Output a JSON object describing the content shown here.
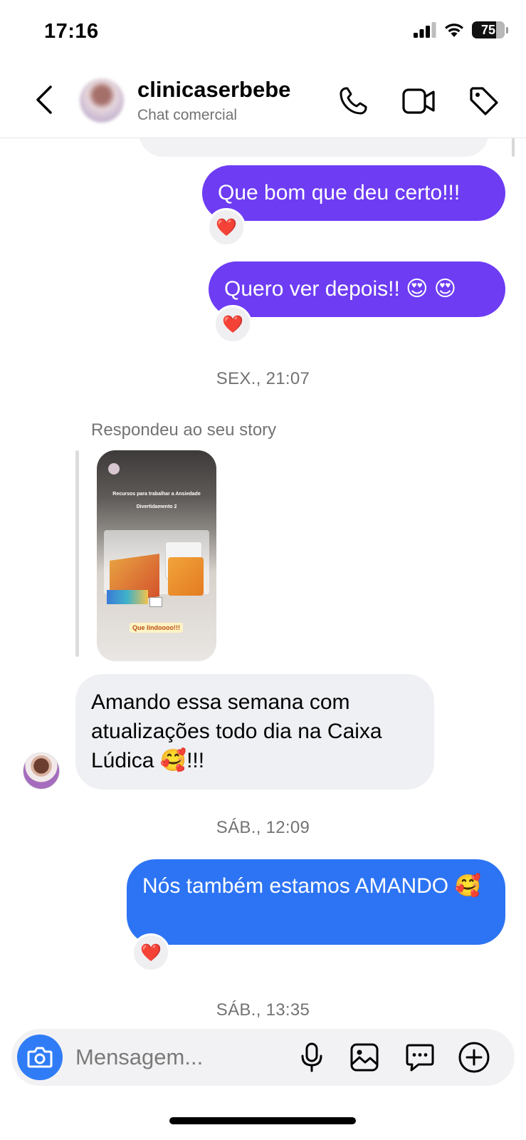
{
  "status_bar": {
    "time": "17:16",
    "battery": "75",
    "icons": [
      "cellular-signal-icon",
      "wifi-icon",
      "battery-icon"
    ]
  },
  "header": {
    "back_icon": "chevron-left-icon",
    "name": "clinicaserbebe",
    "subtitle": "Chat comercial",
    "actions": [
      "phone-icon",
      "video-camera-icon",
      "tag-icon"
    ]
  },
  "colors": {
    "sent_purple": "#6d3cf3",
    "sent_blue": "#2d74f4",
    "received": "#eff0f3",
    "reaction_heart": "#ee1d34",
    "camera_button": "#2f7cf6"
  },
  "messages": {
    "m1": {
      "text": "Que bom que deu certo!!!",
      "reaction": "❤️"
    },
    "m2": {
      "text": "Quero ver depois!! 😍 😍",
      "reaction": "❤️"
    },
    "ts1": "SEX., 21:07",
    "story_reply": {
      "label": "Respondeu ao seu story",
      "story_title": "Recursos para trabalhar a Ansiedade",
      "story_subtitle": "Divertidamento 2",
      "story_sticker": "Que lindoooo!!!"
    },
    "m3": {
      "text": "Amando essa semana com atualizações todo dia na Caixa Lúdica 🥰!!!"
    },
    "ts2": "SÁB., 12:09",
    "m4": {
      "text": "Nós também estamos AMANDO 🥰",
      "reaction": "❤️"
    },
    "ts3": "SÁB., 13:35"
  },
  "composer": {
    "placeholder": "Mensagem...",
    "value": "",
    "icons": [
      "camera-icon",
      "microphone-icon",
      "gallery-icon",
      "sticker-icon",
      "plus-circle-icon"
    ]
  }
}
